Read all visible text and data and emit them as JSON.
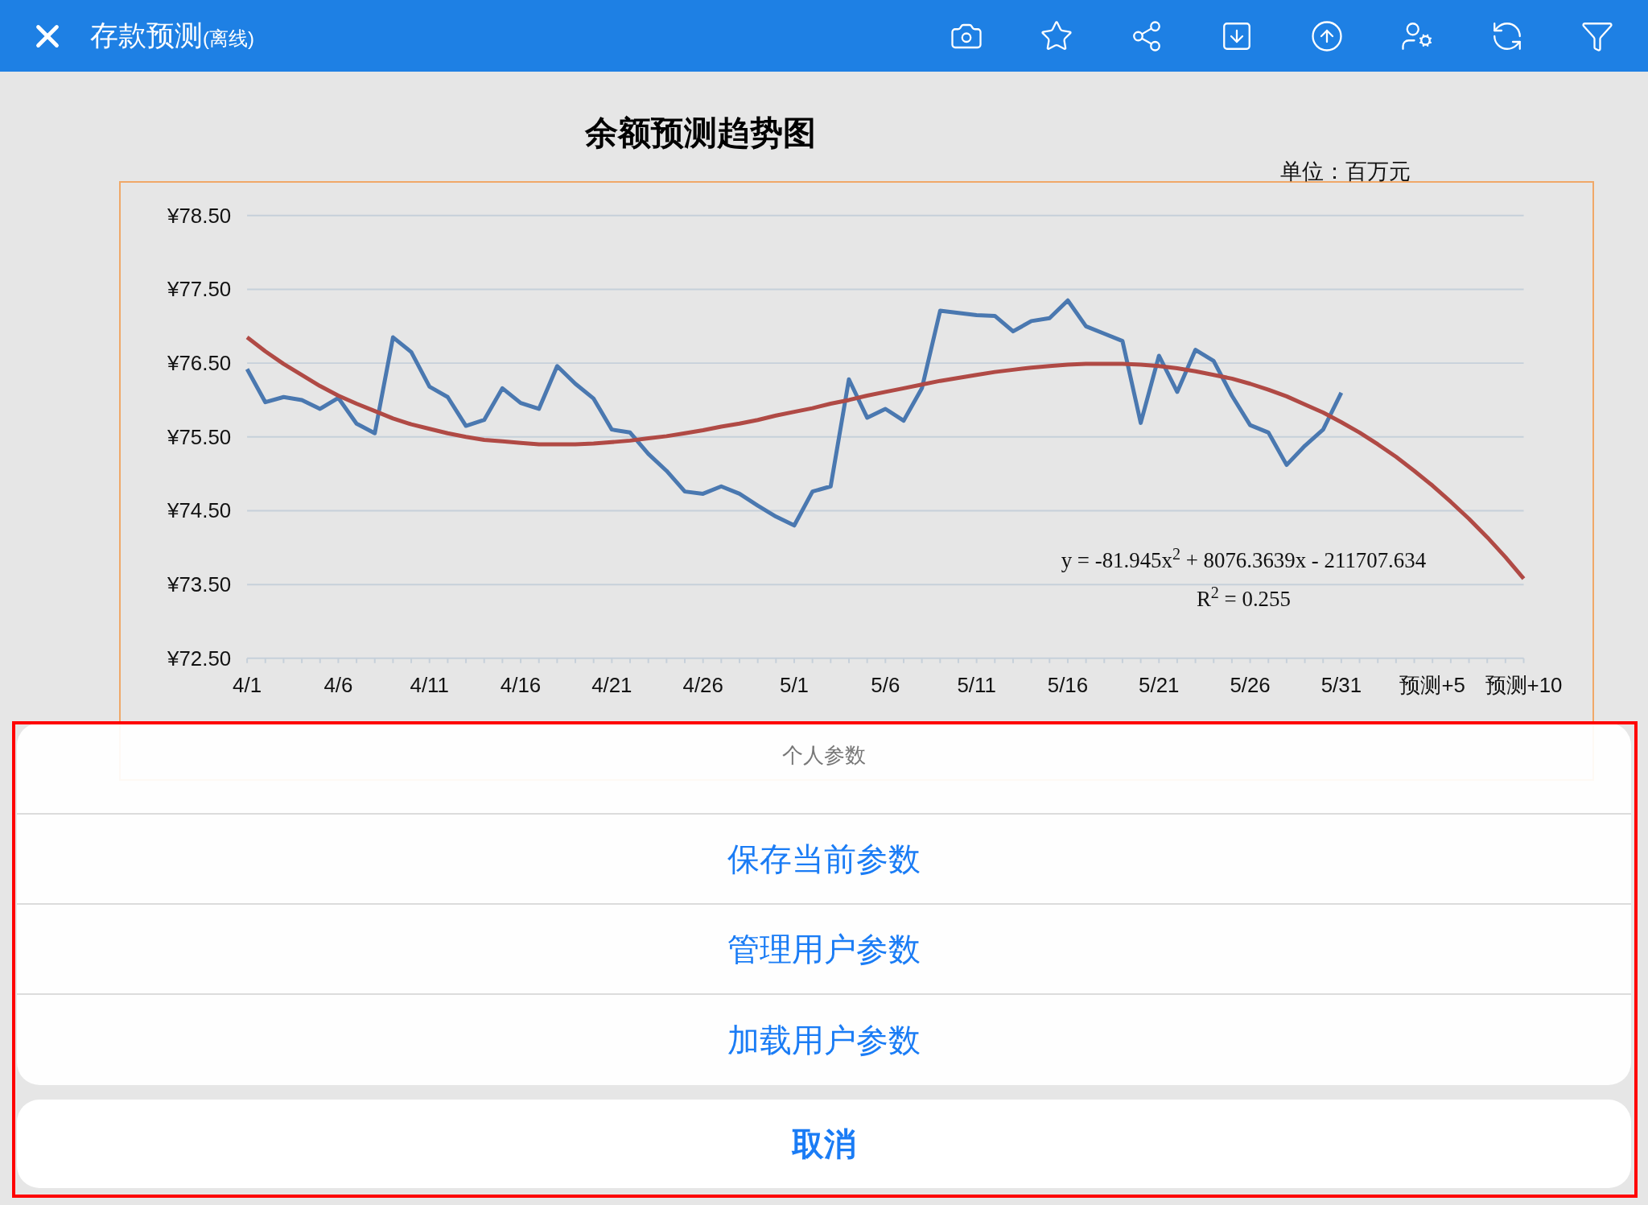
{
  "header": {
    "title": "存款预测",
    "subtitle": "(离线)"
  },
  "chart": {
    "title": "余额预测趋势图",
    "unit": "单位：百万元",
    "chart_data": {
      "type": "line",
      "grid": true,
      "ylim": [
        72.5,
        78.5
      ],
      "categories": [
        "4/1",
        null,
        null,
        null,
        null,
        "4/6",
        null,
        null,
        null,
        null,
        "4/11",
        null,
        null,
        null,
        null,
        "4/16",
        null,
        null,
        null,
        null,
        "4/21",
        null,
        null,
        null,
        null,
        "4/26",
        null,
        null,
        null,
        null,
        "5/1",
        null,
        null,
        null,
        null,
        "5/6",
        null,
        null,
        null,
        null,
        "5/11",
        null,
        null,
        null,
        null,
        "5/16",
        null,
        null,
        null,
        null,
        "5/21",
        null,
        null,
        null,
        null,
        "5/26",
        null,
        null,
        null,
        null,
        "5/31",
        null,
        null,
        null,
        null,
        "预测+5",
        null,
        null,
        null,
        null,
        "预测+10"
      ],
      "yticks": [
        {
          "value": 78.5,
          "label": "¥78.50"
        },
        {
          "value": 77.5,
          "label": "¥77.50"
        },
        {
          "value": 76.5,
          "label": "¥76.50"
        },
        {
          "value": 75.5,
          "label": "¥75.50"
        },
        {
          "value": 74.5,
          "label": "¥74.50"
        },
        {
          "value": 73.5,
          "label": "¥73.50"
        },
        {
          "value": 72.5,
          "label": "¥72.50"
        }
      ],
      "series": [
        {
          "color": "#4a78b0",
          "values": [
            76.42,
            75.97,
            76.04,
            76.0,
            75.88,
            76.03,
            75.68,
            75.55,
            76.85,
            76.65,
            76.18,
            76.04,
            75.65,
            75.73,
            76.16,
            75.96,
            75.88,
            76.46,
            76.22,
            76.02,
            75.6,
            75.56,
            75.27,
            75.04,
            74.76,
            74.73,
            74.83,
            74.73,
            74.57,
            74.42,
            74.3,
            74.76,
            74.83,
            76.28,
            75.76,
            75.88,
            75.72,
            76.16,
            77.21,
            77.18,
            77.15,
            77.14,
            76.93,
            77.07,
            77.11,
            77.35,
            77.0,
            76.9,
            76.8,
            75.69,
            76.6,
            76.11,
            76.68,
            76.53,
            76.06,
            75.66,
            75.56,
            75.12,
            75.38,
            75.6,
            76.1,
            null,
            null,
            null,
            null,
            null,
            null,
            null,
            null,
            null,
            null
          ]
        },
        {
          "color": "#b04a45",
          "values": [
            76.85,
            76.66,
            76.49,
            76.34,
            76.19,
            76.06,
            75.95,
            75.85,
            75.75,
            75.67,
            75.61,
            75.55,
            75.5,
            75.46,
            75.44,
            75.42,
            75.4,
            75.4,
            75.4,
            75.41,
            75.43,
            75.45,
            75.48,
            75.51,
            75.55,
            75.59,
            75.64,
            75.68,
            75.73,
            75.79,
            75.84,
            75.89,
            75.95,
            76.0,
            76.06,
            76.11,
            76.16,
            76.21,
            76.26,
            76.3,
            76.34,
            76.38,
            76.41,
            76.44,
            76.46,
            76.48,
            76.49,
            76.49,
            76.49,
            76.48,
            76.46,
            76.43,
            76.39,
            76.34,
            76.29,
            76.22,
            76.14,
            76.05,
            75.94,
            75.83,
            75.7,
            75.56,
            75.4,
            75.23,
            75.04,
            74.84,
            74.62,
            74.39,
            74.14,
            73.87,
            73.58
          ]
        }
      ],
      "annotations": [
        "y = -81.945x$^{2}$ + 8076.3639x - 211707.634",
        "R$^{2}$ = 0.255"
      ]
    }
  },
  "action_sheet": {
    "title": "个人参数",
    "options": [
      "保存当前参数",
      "管理用户参数",
      "加载用户参数"
    ],
    "cancel": "取消"
  }
}
